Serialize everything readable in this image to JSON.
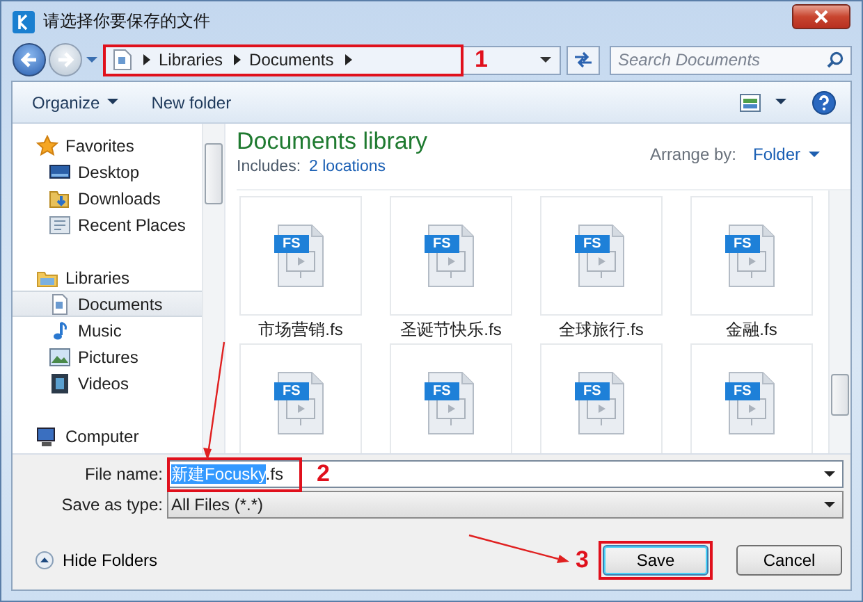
{
  "window": {
    "title": "请选择你要保存的文件"
  },
  "address_bar": {
    "path": [
      "Libraries",
      "Documents"
    ],
    "callout": {
      "number": "1"
    }
  },
  "search": {
    "placeholder": "Search Documents"
  },
  "toolbar": {
    "items": [
      {
        "label": "Organize",
        "dropdown": true
      },
      {
        "label": "New folder",
        "dropdown": false
      }
    ]
  },
  "sidebar": {
    "groups": [
      {
        "label": "Favorites",
        "kind": "favorites",
        "children": [
          {
            "label": "Desktop",
            "kind": "desktop",
            "selected": false
          },
          {
            "label": "Downloads",
            "kind": "downloads",
            "selected": false
          },
          {
            "label": "Recent Places",
            "kind": "recent",
            "selected": false
          }
        ]
      },
      {
        "label": "Libraries",
        "kind": "libraries",
        "children": [
          {
            "label": "Documents",
            "kind": "documents",
            "selected": true
          },
          {
            "label": "Music",
            "kind": "music",
            "selected": false
          },
          {
            "label": "Pictures",
            "kind": "pictures",
            "selected": false
          },
          {
            "label": "Videos",
            "kind": "videos",
            "selected": false
          }
        ]
      },
      {
        "label": "Computer",
        "kind": "computer"
      }
    ]
  },
  "library": {
    "title": "Documents library",
    "includes_label": "Includes:",
    "includes_link": "2 locations",
    "arrange_label": "Arrange by:",
    "arrange_value": "Folder"
  },
  "files": [
    {
      "name": "市场营销.fs",
      "badge": "FS"
    },
    {
      "name": "圣诞节快乐.fs",
      "badge": "FS"
    },
    {
      "name": "全球旅行.fs",
      "badge": "FS"
    },
    {
      "name": "金融.fs",
      "badge": "FS"
    },
    {
      "badge": "FS"
    },
    {
      "badge": "FS"
    },
    {
      "badge": "FS"
    },
    {
      "badge": "FS"
    }
  ],
  "file_name": {
    "label": "File name:",
    "selected_text": "新建Focusky",
    "rest_text": ".fs",
    "callout": {
      "number": "2"
    }
  },
  "save_type": {
    "label": "Save as type:",
    "value": "All Files (*.*)"
  },
  "hide_folders": "Hide Folders",
  "buttons": [
    {
      "label": "Save",
      "focused": true,
      "callout": {
        "number": "3"
      }
    },
    {
      "label": "Cancel",
      "focused": false
    }
  ]
}
